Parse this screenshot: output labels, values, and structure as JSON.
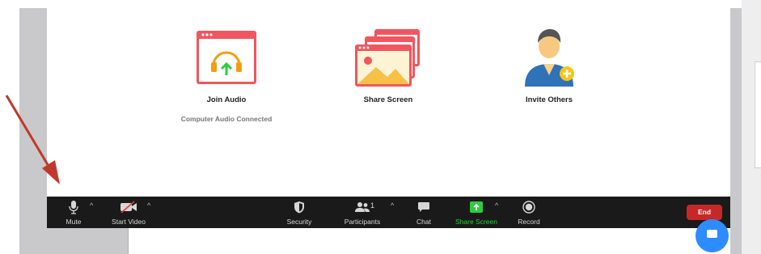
{
  "main_actions": [
    {
      "label": "Join Audio",
      "sub": "Computer Audio Connected"
    },
    {
      "label": "Share Screen"
    },
    {
      "label": "Invite Others"
    }
  ],
  "toolbar": {
    "mute": "Mute",
    "start_video": "Start Video",
    "security": "Security",
    "participants": "Participants",
    "participants_count": "1",
    "chat": "Chat",
    "share_screen": "Share Screen",
    "record": "Record",
    "end": "End",
    "caret": "^"
  },
  "colors": {
    "toolbar_bg": "#1a1a1a",
    "end_red": "#c62828",
    "share_green": "#2ecc40",
    "card_red": "#f0565f",
    "help_blue": "#2d8cff",
    "annotation_arrow": "#c0392b"
  },
  "icons": [
    "headphones-icon",
    "gallery-icon",
    "add-person-icon",
    "microphone-icon",
    "video-off-icon",
    "shield-icon",
    "participants-icon",
    "chat-icon",
    "share-arrow-icon",
    "record-icon",
    "chat-bubble-icon"
  ]
}
